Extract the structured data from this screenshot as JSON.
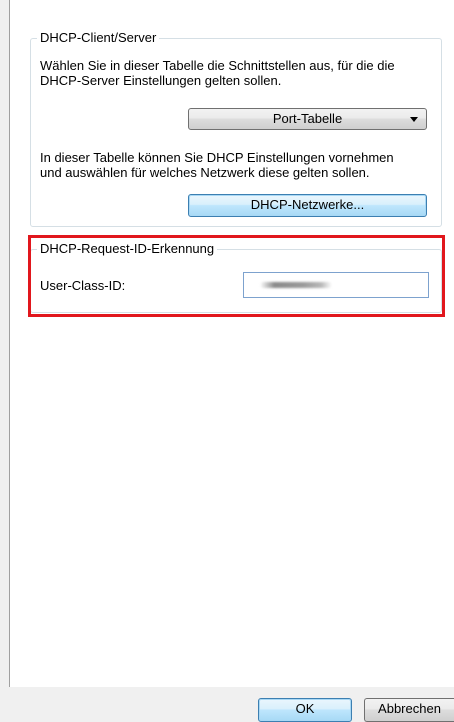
{
  "group_dhcp": {
    "legend": "DHCP-Client/Server",
    "desc1_line1": "Wählen Sie in dieser Tabelle die Schnittstellen aus, für die die",
    "desc1_line2": "DHCP-Server Einstellungen gelten sollen.",
    "port_table_label": "Port-Tabelle",
    "desc2_line1": "In dieser Tabelle können Sie DHCP Einstellungen vornehmen",
    "desc2_line2": "und auswählen für welches Netzwerk diese gelten sollen.",
    "networks_button_label": "DHCP-Netzwerke..."
  },
  "group_request_id": {
    "legend": "DHCP-Request-ID-Erkennung",
    "user_class_label": "User-Class-ID:",
    "user_class_value": ""
  },
  "footer": {
    "ok_label": "OK",
    "cancel_label": "Abbrechen"
  },
  "colors": {
    "highlight": "#e1171d",
    "focus_border": "#3c7fb1"
  }
}
